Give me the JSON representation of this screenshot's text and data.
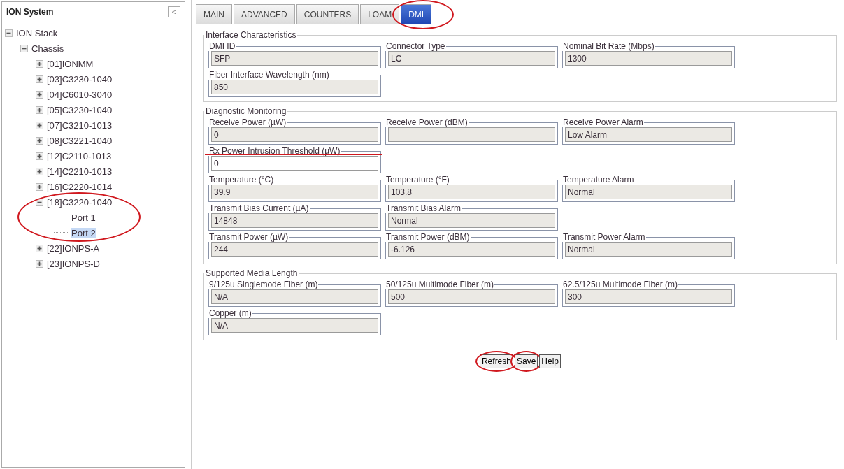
{
  "sidebar": {
    "title": "ION System",
    "collapse_button": "<",
    "tree": [
      {
        "label": "ION Stack",
        "expanded": true,
        "children": [
          {
            "label": "Chassis",
            "expanded": true,
            "children": [
              {
                "label": "[01]IONMM",
                "expanded": false
              },
              {
                "label": "[03]C3230-1040",
                "expanded": false
              },
              {
                "label": "[04]C6010-3040",
                "expanded": false
              },
              {
                "label": "[05]C3230-1040",
                "expanded": false
              },
              {
                "label": "[07]C3210-1013",
                "expanded": false
              },
              {
                "label": "[08]C3221-1040",
                "expanded": false
              },
              {
                "label": "[12]C2110-1013",
                "expanded": false
              },
              {
                "label": "[14]C2210-1013",
                "expanded": false
              },
              {
                "label": "[16]C2220-1014",
                "expanded": false
              },
              {
                "label": "[18]C3220-1040",
                "expanded": true,
                "highlighted": true,
                "children": [
                  {
                    "label": "Port 1",
                    "selected": false
                  },
                  {
                    "label": "Port 2",
                    "selected": true
                  }
                ]
              },
              {
                "label": "[22]IONPS-A",
                "expanded": false
              },
              {
                "label": "[23]IONPS-D",
                "expanded": false
              }
            ]
          }
        ]
      }
    ]
  },
  "tabs": [
    {
      "label": "MAIN",
      "selected": false,
      "highlighted": false
    },
    {
      "label": "ADVANCED",
      "selected": false,
      "highlighted": false
    },
    {
      "label": "COUNTERS",
      "selected": false,
      "highlighted": false
    },
    {
      "label": "LOAM",
      "selected": false,
      "highlighted": false
    },
    {
      "label": "DMI",
      "selected": true,
      "highlighted": true
    }
  ],
  "sections": [
    {
      "title": "Interface Characteristics",
      "rows": [
        [
          {
            "label": "DMI ID",
            "value": "SFP",
            "editable": false
          },
          {
            "label": "Connector Type",
            "value": "LC",
            "editable": false
          },
          {
            "label": "Nominal Bit Rate (Mbps)",
            "value": "1300",
            "editable": false
          }
        ],
        [
          {
            "label": "Fiber Interface Wavelength (nm)",
            "value": "850",
            "editable": false
          }
        ]
      ]
    },
    {
      "title": "Diagnostic Monitoring",
      "rows": [
        [
          {
            "label": "Receive Power (µW)",
            "value": "0",
            "editable": false
          },
          {
            "label": "Receive Power (dBM)",
            "editable": false
          },
          {
            "label": "Receive Power Alarm",
            "value": "Low Alarm",
            "editable": false
          }
        ],
        [
          {
            "label": "Rx Power Intrusion Threshold (µW)",
            "value": "0",
            "editable": true,
            "underlined": true
          }
        ],
        [
          {
            "label": "Temperature (°C)",
            "value": "39.9",
            "editable": false
          },
          {
            "label": "Temperature (°F)",
            "value": "103.8",
            "editable": false
          },
          {
            "label": "Temperature Alarm",
            "value": "Normal",
            "editable": false
          }
        ],
        [
          {
            "label": "Transmit Bias Current (µA)",
            "value": "14848",
            "editable": false
          },
          {
            "label": "Transmit Bias Alarm",
            "value": "Normal",
            "editable": false
          }
        ],
        [
          {
            "label": "Transmit Power (µW)",
            "value": "244",
            "editable": false
          },
          {
            "label": "Transmit Power (dBM)",
            "value": "-6.126",
            "editable": false
          },
          {
            "label": "Transmit Power Alarm",
            "value": "Normal",
            "editable": false
          }
        ]
      ]
    },
    {
      "title": "Supported Media Length",
      "rows": [
        [
          {
            "label": "9/125u Singlemode Fiber (m)",
            "value": "N/A",
            "editable": false
          },
          {
            "label": "50/125u Multimode Fiber (m)",
            "value": "500",
            "editable": false
          },
          {
            "label": "62.5/125u Multimode Fiber (m)",
            "value": "300",
            "editable": false
          }
        ],
        [
          {
            "label": "Copper (m)",
            "value": "N/A",
            "editable": false
          }
        ]
      ]
    }
  ],
  "buttons": [
    {
      "label": "Refresh",
      "highlighted": true
    },
    {
      "label": "Save",
      "highlighted": true
    },
    {
      "label": "Help",
      "highlighted": false
    }
  ]
}
